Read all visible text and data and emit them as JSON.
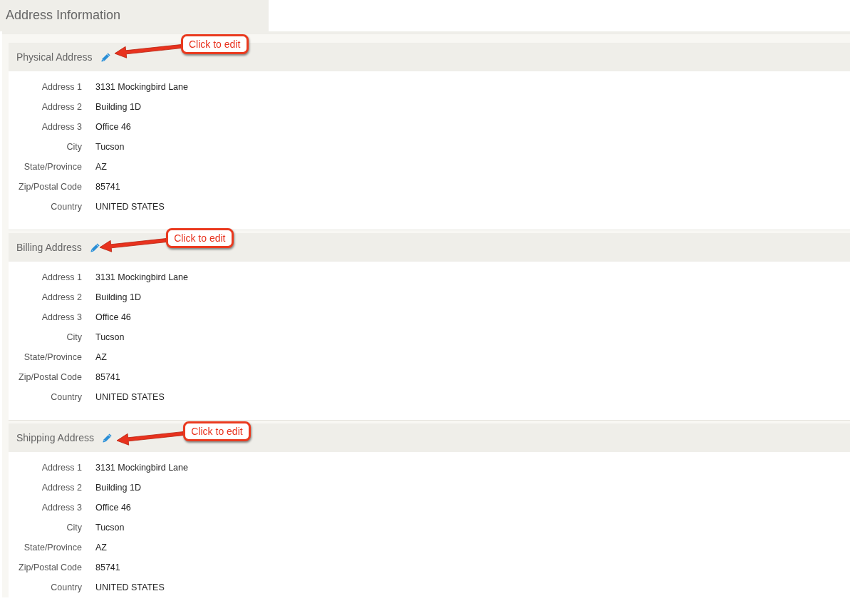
{
  "page_title": "Address Information",
  "sections": [
    {
      "title": "Physical Address",
      "callout": "Click to edit",
      "fields": [
        {
          "label": "Address 1",
          "value": "3131 Mockingbird Lane"
        },
        {
          "label": "Address 2",
          "value": "Building 1D"
        },
        {
          "label": "Address 3",
          "value": "Office 46"
        },
        {
          "label": "City",
          "value": "Tucson"
        },
        {
          "label": "State/Province",
          "value": "AZ"
        },
        {
          "label": "Zip/Postal Code",
          "value": "85741"
        },
        {
          "label": "Country",
          "value": "UNITED STATES"
        }
      ]
    },
    {
      "title": "Billing Address",
      "callout": "Click to edit",
      "fields": [
        {
          "label": "Address 1",
          "value": "3131 Mockingbird Lane"
        },
        {
          "label": "Address 2",
          "value": "Building 1D"
        },
        {
          "label": "Address 3",
          "value": "Office 46"
        },
        {
          "label": "City",
          "value": "Tucson"
        },
        {
          "label": "State/Province",
          "value": "AZ"
        },
        {
          "label": "Zip/Postal Code",
          "value": "85741"
        },
        {
          "label": "Country",
          "value": "UNITED STATES"
        }
      ]
    },
    {
      "title": "Shipping Address",
      "callout": "Click to edit",
      "fields": [
        {
          "label": "Address 1",
          "value": "3131 Mockingbird Lane"
        },
        {
          "label": "Address 2",
          "value": "Building 1D"
        },
        {
          "label": "Address 3",
          "value": "Office 46"
        },
        {
          "label": "City",
          "value": "Tucson"
        },
        {
          "label": "State/Province",
          "value": "AZ"
        },
        {
          "label": "Zip/Postal Code",
          "value": "85741"
        },
        {
          "label": "Country",
          "value": "UNITED STATES"
        }
      ]
    }
  ]
}
